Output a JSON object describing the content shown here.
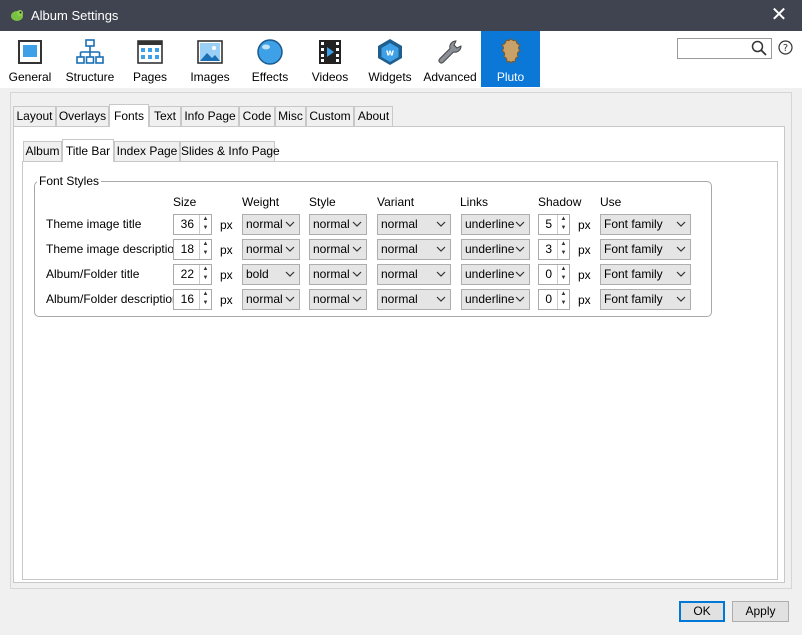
{
  "window": {
    "title": "Album Settings"
  },
  "toolbar": {
    "items": [
      {
        "label": "General"
      },
      {
        "label": "Structure"
      },
      {
        "label": "Pages"
      },
      {
        "label": "Images"
      },
      {
        "label": "Effects"
      },
      {
        "label": "Videos"
      },
      {
        "label": "Widgets"
      },
      {
        "label": "Advanced"
      },
      {
        "label": "Pluto"
      }
    ],
    "search_value": "",
    "accent": "#0b78d7"
  },
  "tabs": [
    "Layout",
    "Overlays",
    "Fonts",
    "Text",
    "Info Page",
    "Code",
    "Misc",
    "Custom",
    "About"
  ],
  "subtabs": [
    "Album",
    "Title Bar",
    "Index Page",
    "Slides & Info Page"
  ],
  "font_styles": {
    "legend": "Font Styles",
    "columns": [
      "Size",
      "Weight",
      "Style",
      "Variant",
      "Links",
      "Shadow",
      "Use"
    ],
    "unit": "px",
    "rows": [
      {
        "label": "Theme image title",
        "size": "36",
        "weight": "normal",
        "style": "normal",
        "variant": "normal",
        "links": "underline",
        "shadow": "5",
        "use": "Font family"
      },
      {
        "label": "Theme image description",
        "size": "18",
        "weight": "normal",
        "style": "normal",
        "variant": "normal",
        "links": "underline",
        "shadow": "3",
        "use": "Font family"
      },
      {
        "label": "Album/Folder title",
        "size": "22",
        "weight": "bold",
        "style": "normal",
        "variant": "normal",
        "links": "underline",
        "shadow": "0",
        "use": "Font family"
      },
      {
        "label": "Album/Folder description",
        "size": "16",
        "weight": "normal",
        "style": "normal",
        "variant": "normal",
        "links": "underline",
        "shadow": "0",
        "use": "Font family"
      }
    ]
  },
  "buttons": {
    "ok": "OK",
    "apply": "Apply"
  }
}
